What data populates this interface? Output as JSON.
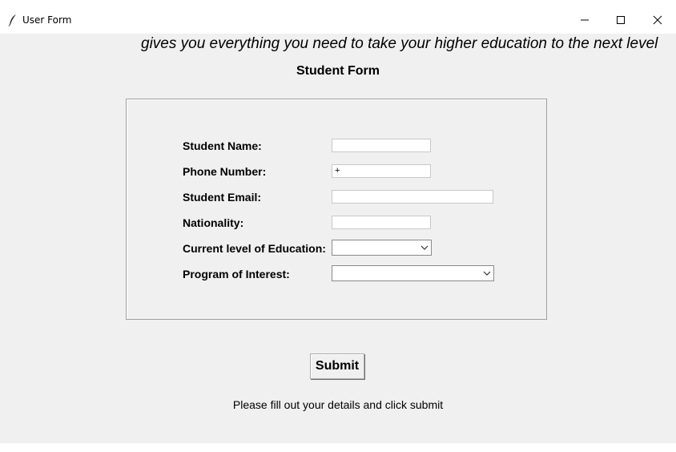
{
  "window": {
    "title": "User Form",
    "icon": "feather-icon"
  },
  "banner": {
    "text": "gives you everything you need to take your higher education to the next level"
  },
  "form": {
    "title": "Student Form",
    "fields": {
      "student_name": {
        "label": "Student Name:",
        "value": ""
      },
      "phone_number": {
        "label": "Phone Number:",
        "value": "+"
      },
      "student_email": {
        "label": "Student Email:",
        "value": ""
      },
      "nationality": {
        "label": "Nationality:",
        "value": ""
      },
      "education_level": {
        "label": "Current level of Education:",
        "selected": ""
      },
      "program_of_interest": {
        "label": "Program of Interest:",
        "selected": ""
      }
    }
  },
  "submit": {
    "label": "Submit"
  },
  "status": {
    "text": "Please fill out your details and click submit"
  }
}
